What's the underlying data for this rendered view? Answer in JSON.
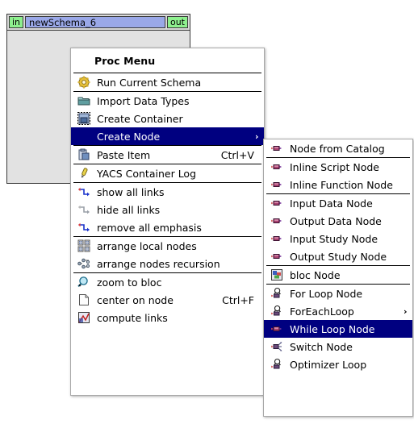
{
  "canvas": {
    "node": {
      "in_port_label": "in",
      "title": "newSchema_6",
      "out_port_label": "out"
    }
  },
  "colors": {
    "highlight": "#000080",
    "highlight_text": "#ffffff",
    "menu_bg": "#ffffff",
    "node_title_bg": "#9aa8e8",
    "port_bg": "#8ef08e",
    "canvas_bg": "#e2e2e2"
  },
  "proc_menu": {
    "title": "Proc Menu",
    "groups": [
      {
        "items": [
          {
            "label": "Run Current Schema",
            "icon": "gear-icon",
            "accel": "",
            "selected": false,
            "submenu": false
          }
        ]
      },
      {
        "items": [
          {
            "label": "Import Data Types",
            "icon": "import-folder-icon",
            "accel": "",
            "selected": false,
            "submenu": false
          },
          {
            "label": "Create Container",
            "icon": "create-container-icon",
            "accel": "",
            "selected": false,
            "submenu": false
          },
          {
            "label": "Create Node",
            "icon": "create-node-icon",
            "accel": "",
            "selected": true,
            "submenu": true
          }
        ]
      },
      {
        "items": [
          {
            "label": "Paste Item",
            "icon": "paste-icon",
            "accel": "Ctrl+V",
            "selected": false,
            "submenu": false
          }
        ]
      },
      {
        "items": [
          {
            "label": "YACS Container Log",
            "icon": "log-icon",
            "accel": "",
            "selected": false,
            "submenu": false
          }
        ]
      },
      {
        "items": [
          {
            "label": "show all links",
            "icon": "show-links-icon",
            "accel": "",
            "selected": false,
            "submenu": false
          },
          {
            "label": "hide all links",
            "icon": "hide-links-icon",
            "accel": "",
            "selected": false,
            "submenu": false
          },
          {
            "label": "remove all emphasis",
            "icon": "remove-emphasis-icon",
            "accel": "",
            "selected": false,
            "submenu": false
          }
        ]
      },
      {
        "items": [
          {
            "label": "arrange local nodes",
            "icon": "arrange-local-icon",
            "accel": "",
            "selected": false,
            "submenu": false
          },
          {
            "label": "arrange nodes recursion",
            "icon": "arrange-recursion-icon",
            "accel": "",
            "selected": false,
            "submenu": false
          }
        ]
      },
      {
        "items": [
          {
            "label": "zoom to bloc",
            "icon": "magnifier-icon",
            "accel": "",
            "selected": false,
            "submenu": false
          },
          {
            "label": "center on node",
            "icon": "page-icon",
            "accel": "Ctrl+F",
            "selected": false,
            "submenu": false
          },
          {
            "label": "compute links",
            "icon": "compute-links-icon",
            "accel": "",
            "selected": false,
            "submenu": false
          }
        ]
      }
    ]
  },
  "node_submenu": {
    "groups": [
      {
        "items": [
          {
            "label": "Node from Catalog",
            "icon": "data-node-icon",
            "accel": "",
            "selected": false,
            "submenu": false
          }
        ]
      },
      {
        "items": [
          {
            "label": "Inline Script Node",
            "icon": "data-node-icon",
            "accel": "",
            "selected": false,
            "submenu": false
          },
          {
            "label": "Inline Function Node",
            "icon": "data-node-icon",
            "accel": "",
            "selected": false,
            "submenu": false
          }
        ]
      },
      {
        "items": [
          {
            "label": "Input Data Node",
            "icon": "data-node-icon",
            "accel": "",
            "selected": false,
            "submenu": false
          },
          {
            "label": "Output Data Node",
            "icon": "data-node-icon",
            "accel": "",
            "selected": false,
            "submenu": false
          },
          {
            "label": "Input Study Node",
            "icon": "data-node-icon",
            "accel": "",
            "selected": false,
            "submenu": false
          },
          {
            "label": "Output Study Node",
            "icon": "data-node-icon",
            "accel": "",
            "selected": false,
            "submenu": false
          }
        ]
      },
      {
        "items": [
          {
            "label": "bloc Node",
            "icon": "bloc-node-icon",
            "accel": "",
            "selected": false,
            "submenu": false
          }
        ]
      },
      {
        "items": [
          {
            "label": "For Loop Node",
            "icon": "loop-node-icon",
            "accel": "",
            "selected": false,
            "submenu": false
          },
          {
            "label": "ForEachLoop",
            "icon": "loop-node-icon",
            "accel": "",
            "selected": false,
            "submenu": true
          },
          {
            "label": "While Loop Node",
            "icon": "data-node-icon",
            "accel": "",
            "selected": true,
            "submenu": false
          },
          {
            "label": "Switch Node",
            "icon": "switch-node-icon",
            "accel": "",
            "selected": false,
            "submenu": false
          },
          {
            "label": "Optimizer Loop",
            "icon": "loop-node-icon",
            "accel": "",
            "selected": false,
            "submenu": false
          }
        ]
      }
    ]
  }
}
